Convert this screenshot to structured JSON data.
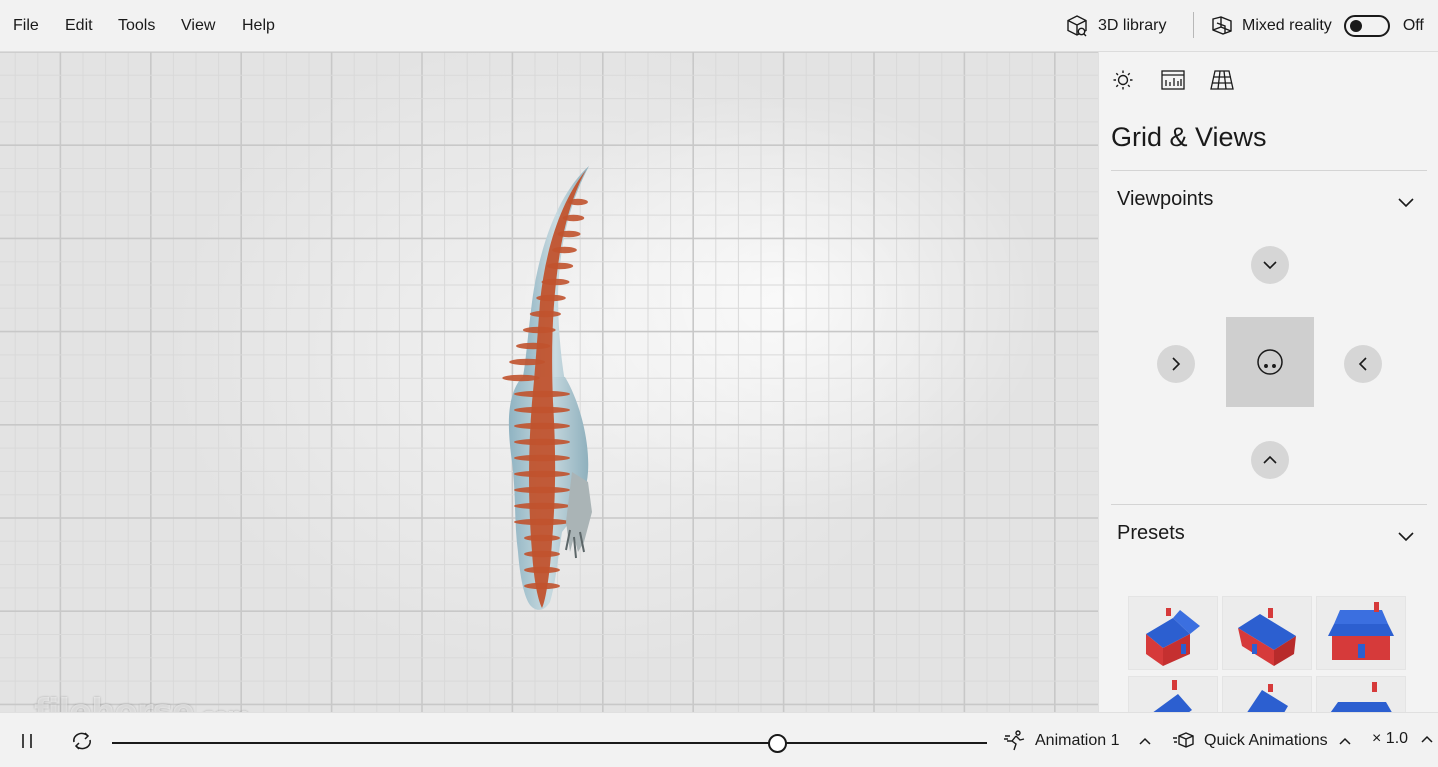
{
  "menu": {
    "file": "File",
    "edit": "Edit",
    "tools": "Tools",
    "view": "View",
    "help": "Help"
  },
  "toolbar": {
    "library": "3D library",
    "mixed_reality": "Mixed reality",
    "toggle_state": "Off"
  },
  "panel": {
    "title": "Grid & Views",
    "tabs": [
      {
        "icon": "lighting-icon"
      },
      {
        "icon": "stats-icon"
      },
      {
        "icon": "grid-views-icon",
        "active": true
      }
    ],
    "viewpoints": {
      "label": "Viewpoints"
    },
    "presets": {
      "label": "Presets"
    }
  },
  "playback": {
    "animation": "Animation 1",
    "quick_animations": "Quick Animations",
    "speed": "× 1.0",
    "progress": 0.76
  },
  "watermark": {
    "name": "filehorse",
    "suffix": ".com"
  },
  "colors": {
    "accent": "#1a1a1a",
    "house_roof": "#2c5fd0",
    "house_wall": "#d63a3a"
  }
}
